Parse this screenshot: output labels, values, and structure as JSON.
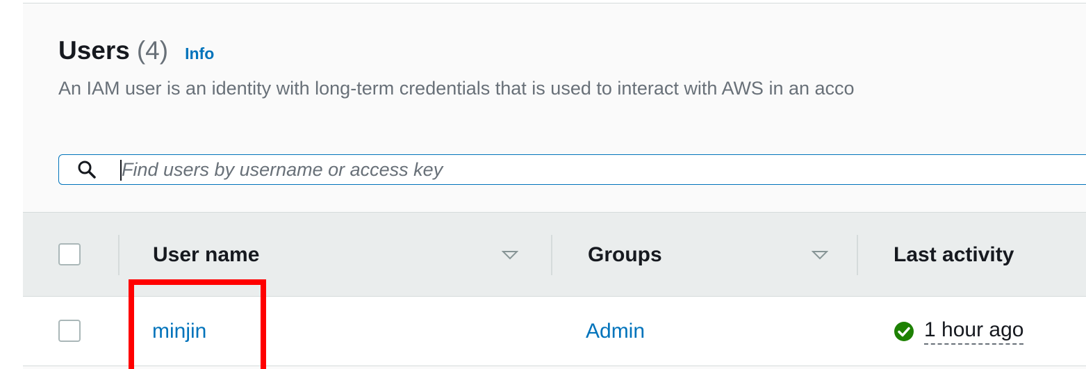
{
  "header": {
    "title": "Users",
    "count": "(4)",
    "info_link": "Info",
    "description": "An IAM user is an identity with long-term credentials that is used to interact with AWS in an acco"
  },
  "search": {
    "placeholder": "Find users by username or access key",
    "value": ""
  },
  "table": {
    "columns": [
      {
        "label": "User name",
        "sortable": true
      },
      {
        "label": "Groups",
        "sortable": true
      },
      {
        "label": "Last activity",
        "sortable": false
      }
    ],
    "rows": [
      {
        "user_name": "minjin",
        "groups": "Admin",
        "last_activity": "1 hour ago",
        "status": "success"
      }
    ]
  },
  "colors": {
    "link": "#0073bb",
    "header_bg": "#eaeded",
    "success": "#1d8102",
    "highlight": "#ff0000"
  },
  "icons": {
    "search": "search-icon",
    "sort": "caret-down-icon",
    "status": "check-circle-icon"
  }
}
